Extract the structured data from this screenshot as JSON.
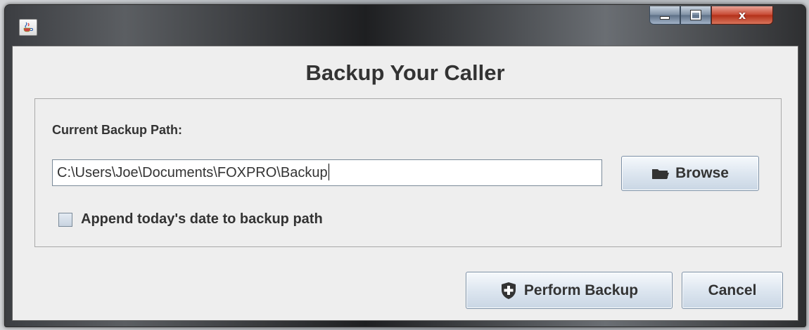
{
  "window": {
    "app_icon": "java-cup-icon",
    "controls": {
      "minimize_icon": "minimize-icon",
      "maximize_icon": "maximize-icon",
      "close_label": "x"
    }
  },
  "dialog": {
    "title": "Backup Your Caller",
    "path_label": "Current Backup Path:",
    "path_value": "C:\\Users\\Joe\\Documents\\FOXPRO\\Backup",
    "browse": {
      "label": "Browse",
      "icon": "folder-icon"
    },
    "append_date": {
      "label": "Append today's date to backup path",
      "checked": false
    },
    "perform_backup": {
      "label": "Perform Backup",
      "icon": "shield-plus-icon"
    },
    "cancel": {
      "label": "Cancel"
    }
  },
  "colors": {
    "client_bg": "#eeeeee",
    "text": "#333333",
    "close_button": "#c6452f",
    "button_border": "#7a8fa6"
  }
}
